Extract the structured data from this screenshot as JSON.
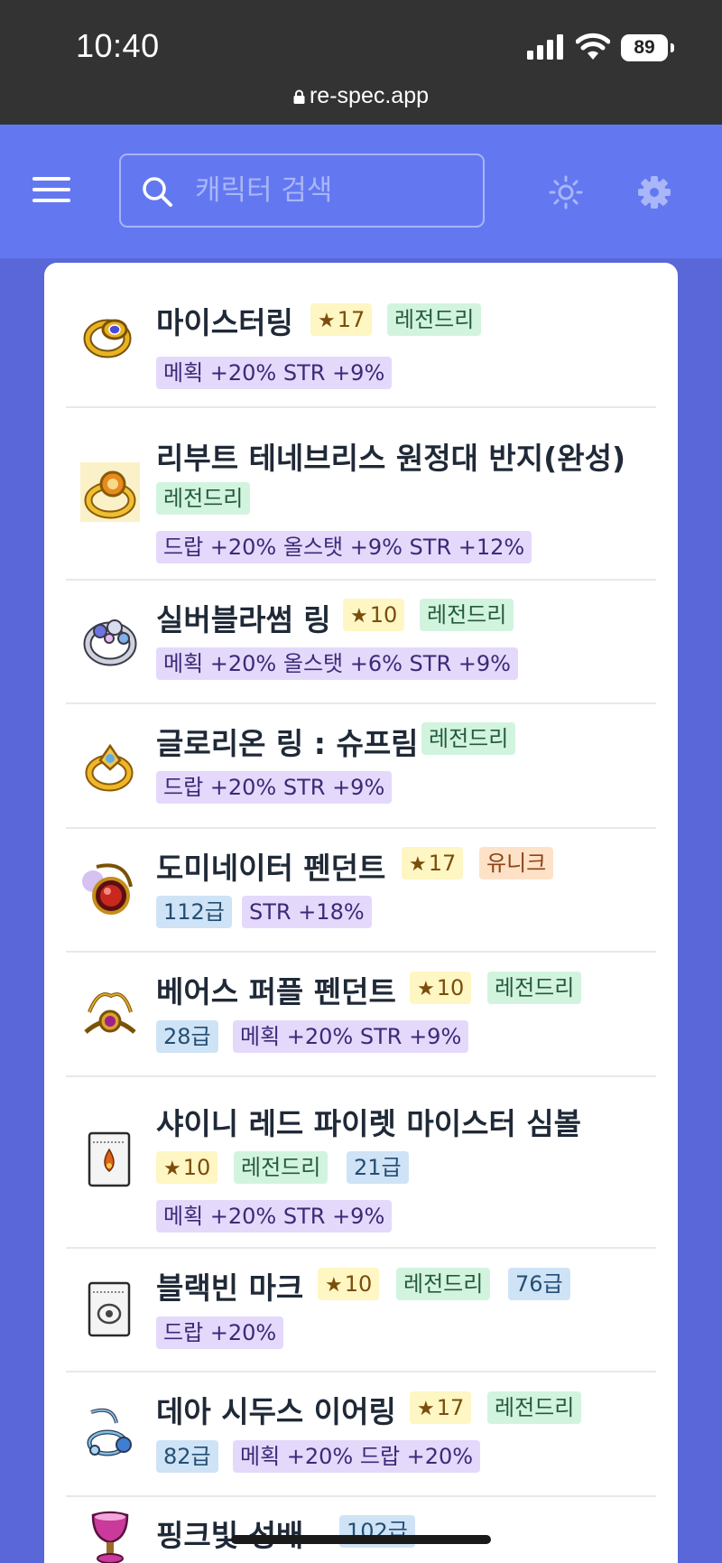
{
  "status_bar": {
    "time": "10:40",
    "battery": "89",
    "url": "re-spec.app"
  },
  "header": {
    "search_placeholder": "캐릭터 검색"
  },
  "items": [
    {
      "name": "마이스터링",
      "star": "17",
      "rarity": "레전드리",
      "options": "메획 +20% STR +9%"
    },
    {
      "name": "리부트 테네브리스 원정대 반지(완성)",
      "rarity": "레전드리",
      "options": "드랍 +20% 올스탯 +9% STR +12%"
    },
    {
      "name": "실버블라썸 링",
      "star": "10",
      "rarity": "레전드리",
      "options": "메획 +20% 올스탯 +6% STR +9%"
    },
    {
      "name": "글로리온 링 : 슈프림",
      "rarity": "레전드리",
      "options": "드랍 +20% STR +9%"
    },
    {
      "name": "도미네이터 펜던트",
      "star": "17",
      "rarity": "유니크",
      "grade": "112급",
      "options": "STR +18%"
    },
    {
      "name": "베어스 퍼플 펜던트",
      "star": "10",
      "rarity": "레전드리",
      "grade": "28급",
      "options": "메획 +20% STR +9%"
    },
    {
      "name": "샤이니 레드 파이렛 마이스터 심볼",
      "star": "10",
      "rarity": "레전드리",
      "grade": "21급",
      "options": "메획 +20% STR +9%"
    },
    {
      "name": "블랙빈 마크",
      "star": "10",
      "rarity": "레전드리",
      "grade": "76급",
      "options": "드랍 +20%"
    },
    {
      "name": "데아 시두스 이어링",
      "star": "17",
      "rarity": "레전드리",
      "grade": "82급",
      "options": "메획 +20% 드랍 +20%"
    },
    {
      "name": "핑크빛 성배",
      "grade": "102급"
    }
  ]
}
